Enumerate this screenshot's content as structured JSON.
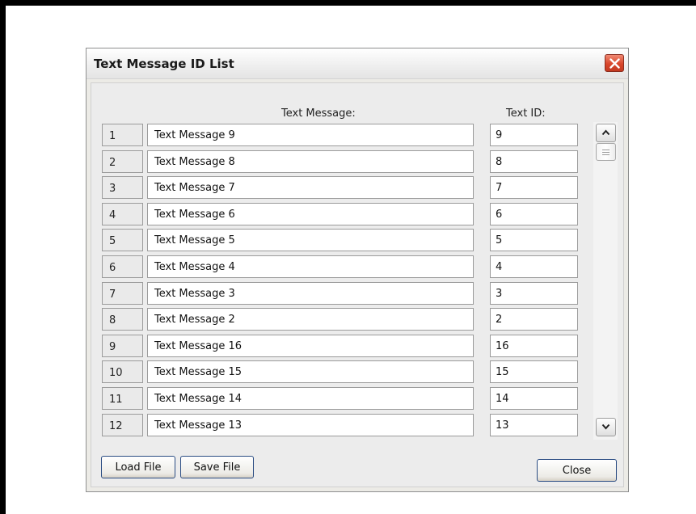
{
  "dialog": {
    "title": "Text Message ID List"
  },
  "table": {
    "header_message": "Text Message:",
    "header_id": "Text ID:",
    "rows": [
      {
        "num": "1",
        "message": "Text Message 9",
        "id": "9"
      },
      {
        "num": "2",
        "message": "Text Message 8",
        "id": "8"
      },
      {
        "num": "3",
        "message": "Text Message 7",
        "id": "7"
      },
      {
        "num": "4",
        "message": "Text Message 6",
        "id": "6"
      },
      {
        "num": "5",
        "message": "Text Message 5",
        "id": "5"
      },
      {
        "num": "6",
        "message": "Text Message 4",
        "id": "4"
      },
      {
        "num": "7",
        "message": "Text Message 3",
        "id": "3"
      },
      {
        "num": "8",
        "message": "Text Message 2",
        "id": "2"
      },
      {
        "num": "9",
        "message": "Text Message 16",
        "id": "16"
      },
      {
        "num": "10",
        "message": "Text Message 15",
        "id": "15"
      },
      {
        "num": "11",
        "message": "Text Message 14",
        "id": "14"
      },
      {
        "num": "12",
        "message": "Text Message 13",
        "id": "13"
      }
    ]
  },
  "buttons": {
    "load": "Load File",
    "save": "Save File",
    "close": "Close"
  },
  "icons": {
    "close": "close-x-icon",
    "scroll_up": "chevron-up-icon",
    "scroll_down": "chevron-down-icon",
    "thumb_grip": "grip-lines-icon"
  },
  "colors": {
    "close_button": "#d9462b",
    "button_border": "#2b4d83"
  }
}
